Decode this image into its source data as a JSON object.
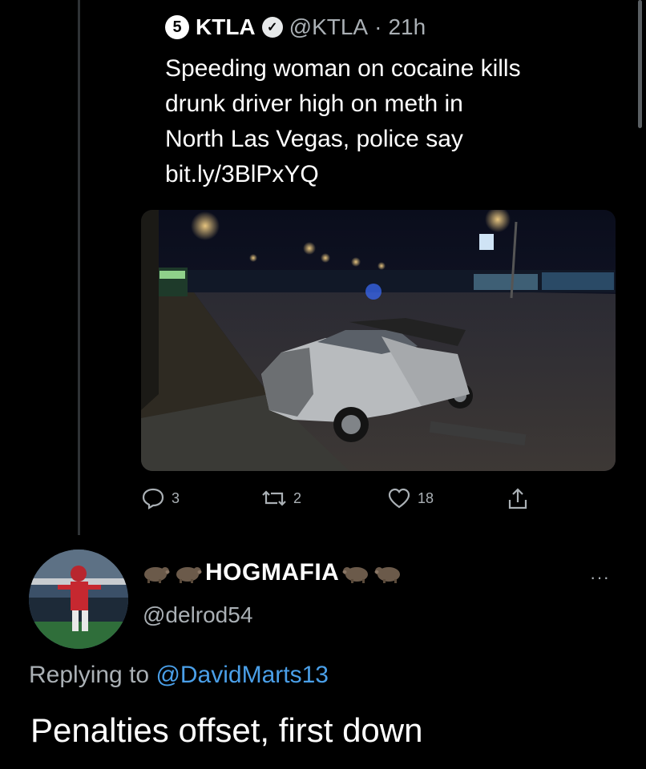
{
  "quoted_tweet": {
    "logo_text": "5",
    "name": "KTLA",
    "handle": "@KTLA",
    "separator": "·",
    "time": "21h",
    "text_lines": [
      "Speeding woman on cocaine kills",
      "drunk driver high on meth in",
      "North Las Vegas, police say",
      "bit.ly/3BlPxYQ"
    ],
    "media_alt": "photo of wrecked silver car at night",
    "actions": {
      "replies": "3",
      "retweets": "2",
      "likes": "18"
    }
  },
  "reply": {
    "display_name": "HOGMAFIA",
    "name_emoji": "hog-emoji",
    "handle": "@delrod54",
    "more_label": "···",
    "replying_prefix": "Replying to ",
    "replying_to": "@DavidMarts13",
    "text": "Penalties offset, first down"
  },
  "colors": {
    "background": "#000000",
    "secondary_text": "#aab0b5",
    "mention": "#4a9fe8",
    "thread_line": "#2f3336"
  }
}
